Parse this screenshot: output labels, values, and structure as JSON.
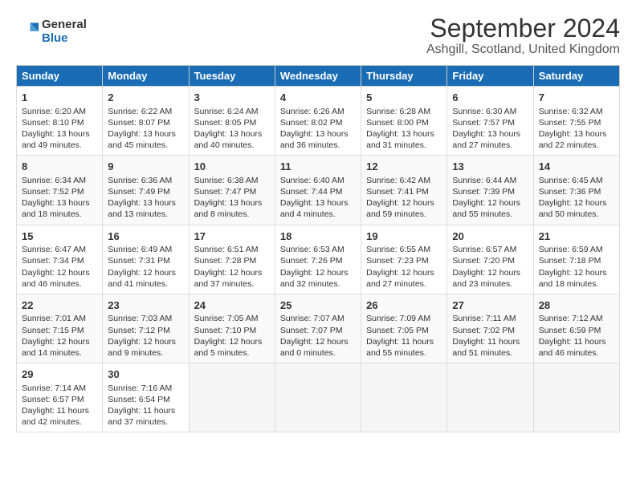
{
  "header": {
    "logo_line1": "General",
    "logo_line2": "Blue",
    "title": "September 2024",
    "subtitle": "Ashgill, Scotland, United Kingdom"
  },
  "days_of_week": [
    "Sunday",
    "Monday",
    "Tuesday",
    "Wednesday",
    "Thursday",
    "Friday",
    "Saturday"
  ],
  "weeks": [
    [
      {
        "day": "1",
        "lines": [
          "Sunrise: 6:20 AM",
          "Sunset: 8:10 PM",
          "Daylight: 13 hours",
          "and 49 minutes."
        ]
      },
      {
        "day": "2",
        "lines": [
          "Sunrise: 6:22 AM",
          "Sunset: 8:07 PM",
          "Daylight: 13 hours",
          "and 45 minutes."
        ]
      },
      {
        "day": "3",
        "lines": [
          "Sunrise: 6:24 AM",
          "Sunset: 8:05 PM",
          "Daylight: 13 hours",
          "and 40 minutes."
        ]
      },
      {
        "day": "4",
        "lines": [
          "Sunrise: 6:26 AM",
          "Sunset: 8:02 PM",
          "Daylight: 13 hours",
          "and 36 minutes."
        ]
      },
      {
        "day": "5",
        "lines": [
          "Sunrise: 6:28 AM",
          "Sunset: 8:00 PM",
          "Daylight: 13 hours",
          "and 31 minutes."
        ]
      },
      {
        "day": "6",
        "lines": [
          "Sunrise: 6:30 AM",
          "Sunset: 7:57 PM",
          "Daylight: 13 hours",
          "and 27 minutes."
        ]
      },
      {
        "day": "7",
        "lines": [
          "Sunrise: 6:32 AM",
          "Sunset: 7:55 PM",
          "Daylight: 13 hours",
          "and 22 minutes."
        ]
      }
    ],
    [
      {
        "day": "8",
        "lines": [
          "Sunrise: 6:34 AM",
          "Sunset: 7:52 PM",
          "Daylight: 13 hours",
          "and 18 minutes."
        ]
      },
      {
        "day": "9",
        "lines": [
          "Sunrise: 6:36 AM",
          "Sunset: 7:49 PM",
          "Daylight: 13 hours",
          "and 13 minutes."
        ]
      },
      {
        "day": "10",
        "lines": [
          "Sunrise: 6:38 AM",
          "Sunset: 7:47 PM",
          "Daylight: 13 hours",
          "and 8 minutes."
        ]
      },
      {
        "day": "11",
        "lines": [
          "Sunrise: 6:40 AM",
          "Sunset: 7:44 PM",
          "Daylight: 13 hours",
          "and 4 minutes."
        ]
      },
      {
        "day": "12",
        "lines": [
          "Sunrise: 6:42 AM",
          "Sunset: 7:41 PM",
          "Daylight: 12 hours",
          "and 59 minutes."
        ]
      },
      {
        "day": "13",
        "lines": [
          "Sunrise: 6:44 AM",
          "Sunset: 7:39 PM",
          "Daylight: 12 hours",
          "and 55 minutes."
        ]
      },
      {
        "day": "14",
        "lines": [
          "Sunrise: 6:45 AM",
          "Sunset: 7:36 PM",
          "Daylight: 12 hours",
          "and 50 minutes."
        ]
      }
    ],
    [
      {
        "day": "15",
        "lines": [
          "Sunrise: 6:47 AM",
          "Sunset: 7:34 PM",
          "Daylight: 12 hours",
          "and 46 minutes."
        ]
      },
      {
        "day": "16",
        "lines": [
          "Sunrise: 6:49 AM",
          "Sunset: 7:31 PM",
          "Daylight: 12 hours",
          "and 41 minutes."
        ]
      },
      {
        "day": "17",
        "lines": [
          "Sunrise: 6:51 AM",
          "Sunset: 7:28 PM",
          "Daylight: 12 hours",
          "and 37 minutes."
        ]
      },
      {
        "day": "18",
        "lines": [
          "Sunrise: 6:53 AM",
          "Sunset: 7:26 PM",
          "Daylight: 12 hours",
          "and 32 minutes."
        ]
      },
      {
        "day": "19",
        "lines": [
          "Sunrise: 6:55 AM",
          "Sunset: 7:23 PM",
          "Daylight: 12 hours",
          "and 27 minutes."
        ]
      },
      {
        "day": "20",
        "lines": [
          "Sunrise: 6:57 AM",
          "Sunset: 7:20 PM",
          "Daylight: 12 hours",
          "and 23 minutes."
        ]
      },
      {
        "day": "21",
        "lines": [
          "Sunrise: 6:59 AM",
          "Sunset: 7:18 PM",
          "Daylight: 12 hours",
          "and 18 minutes."
        ]
      }
    ],
    [
      {
        "day": "22",
        "lines": [
          "Sunrise: 7:01 AM",
          "Sunset: 7:15 PM",
          "Daylight: 12 hours",
          "and 14 minutes."
        ]
      },
      {
        "day": "23",
        "lines": [
          "Sunrise: 7:03 AM",
          "Sunset: 7:12 PM",
          "Daylight: 12 hours",
          "and 9 minutes."
        ]
      },
      {
        "day": "24",
        "lines": [
          "Sunrise: 7:05 AM",
          "Sunset: 7:10 PM",
          "Daylight: 12 hours",
          "and 5 minutes."
        ]
      },
      {
        "day": "25",
        "lines": [
          "Sunrise: 7:07 AM",
          "Sunset: 7:07 PM",
          "Daylight: 12 hours",
          "and 0 minutes."
        ]
      },
      {
        "day": "26",
        "lines": [
          "Sunrise: 7:09 AM",
          "Sunset: 7:05 PM",
          "Daylight: 11 hours",
          "and 55 minutes."
        ]
      },
      {
        "day": "27",
        "lines": [
          "Sunrise: 7:11 AM",
          "Sunset: 7:02 PM",
          "Daylight: 11 hours",
          "and 51 minutes."
        ]
      },
      {
        "day": "28",
        "lines": [
          "Sunrise: 7:12 AM",
          "Sunset: 6:59 PM",
          "Daylight: 11 hours",
          "and 46 minutes."
        ]
      }
    ],
    [
      {
        "day": "29",
        "lines": [
          "Sunrise: 7:14 AM",
          "Sunset: 6:57 PM",
          "Daylight: 11 hours",
          "and 42 minutes."
        ]
      },
      {
        "day": "30",
        "lines": [
          "Sunrise: 7:16 AM",
          "Sunset: 6:54 PM",
          "Daylight: 11 hours",
          "and 37 minutes."
        ]
      },
      {
        "day": "",
        "lines": [],
        "empty": true
      },
      {
        "day": "",
        "lines": [],
        "empty": true
      },
      {
        "day": "",
        "lines": [],
        "empty": true
      },
      {
        "day": "",
        "lines": [],
        "empty": true
      },
      {
        "day": "",
        "lines": [],
        "empty": true
      }
    ]
  ]
}
